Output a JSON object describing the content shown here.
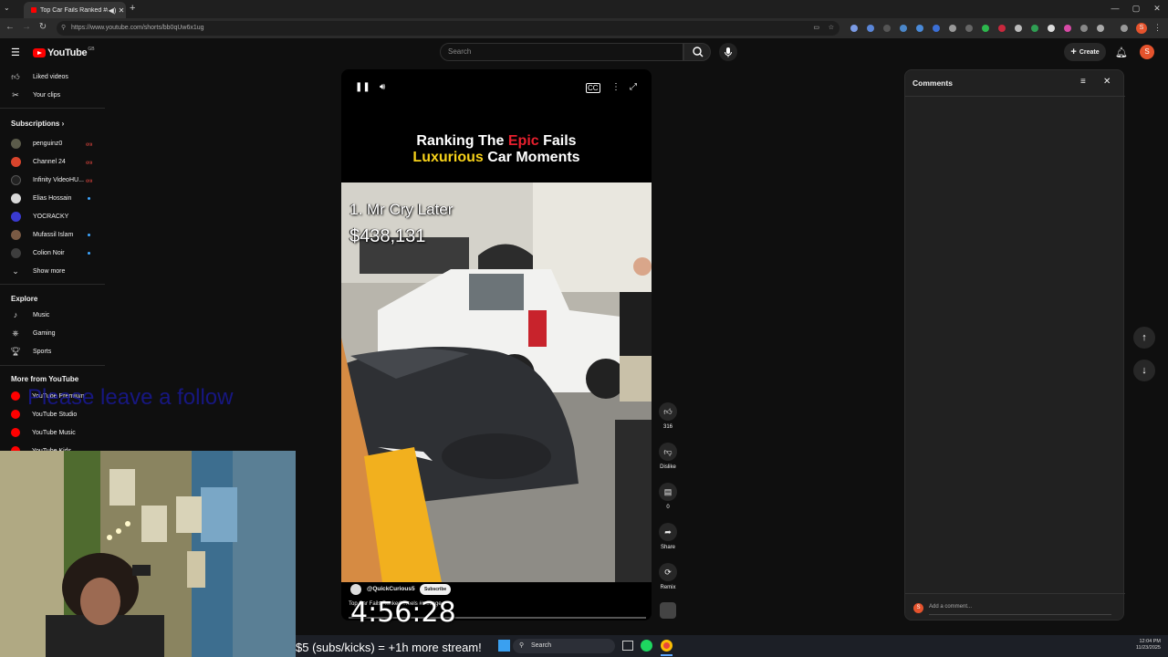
{
  "browser": {
    "tab_title": "Top Car Fails Ranked #reels",
    "url": "https://www.youtube.com/shorts/bb0qUw6x1ug",
    "profile_initial": "S"
  },
  "masthead": {
    "logo_text": "YouTube",
    "country_code": "GB",
    "search_placeholder": "Search",
    "create_label": "Create",
    "avatar_initial": "S"
  },
  "sidebar": {
    "top_items": [
      {
        "label": "Liked videos",
        "icon": "thumbs-up-icon"
      },
      {
        "label": "Your clips",
        "icon": "scissors-icon"
      }
    ],
    "subscriptions_heading": "Subscriptions",
    "subscriptions": [
      {
        "label": "penguinz0",
        "live": true
      },
      {
        "label": "Channel 24",
        "live": true
      },
      {
        "label": "Infinity VideoHU...",
        "live": true
      },
      {
        "label": "Elias Hossain",
        "dot": true
      },
      {
        "label": "YOCRACKY"
      },
      {
        "label": "Mufassil Islam",
        "dot": true
      },
      {
        "label": "Colion Noir",
        "dot": true
      }
    ],
    "show_more": "Show more",
    "explore_heading": "Explore",
    "explore": [
      {
        "label": "Music",
        "icon": "music-note-icon"
      },
      {
        "label": "Gaming",
        "icon": "gamepad-icon"
      },
      {
        "label": "Sports",
        "icon": "trophy-icon"
      }
    ],
    "more_heading": "More from YouTube",
    "more": [
      {
        "label": "YouTube Premium"
      },
      {
        "label": "YouTube Studio"
      },
      {
        "label": "YouTube Music"
      },
      {
        "label": "YouTube Kids"
      }
    ],
    "live_badge": "((•))"
  },
  "overlay_follow": "Please leave a follow",
  "video": {
    "title_line1_pre": "Ranking The ",
    "title_line1_accent": "Epic",
    "title_line1_post": " Fails",
    "title_line2_accent": "Luxurious",
    "title_line2_post": " Car Moments",
    "rank_text": "1. Mr Cry Later",
    "price_text": "$438,131",
    "channel": "@QuickCurious5",
    "subscribe_label": "Subscribe",
    "short_title": "Top Car Fails Ranked #reels #mileage"
  },
  "actions": {
    "likes": "316",
    "dislike_label": "Dislike",
    "comments_count": "0",
    "share_label": "Share",
    "remix_label": "Remix"
  },
  "comments_panel": {
    "title": "Comments",
    "add_placeholder": "Add a comment...",
    "avatar_initial": "S"
  },
  "stream": {
    "timer": "4:56:28",
    "promo": "$5 (subs/kicks) = +1h more stream!"
  },
  "taskbar": {
    "search_label": "Search",
    "time": "12:04 PM",
    "date": "11/23/2025"
  },
  "colors": {
    "youtube_red": "#ff0000",
    "title_red": "#e8202e",
    "title_yellow": "#f6d11a"
  }
}
